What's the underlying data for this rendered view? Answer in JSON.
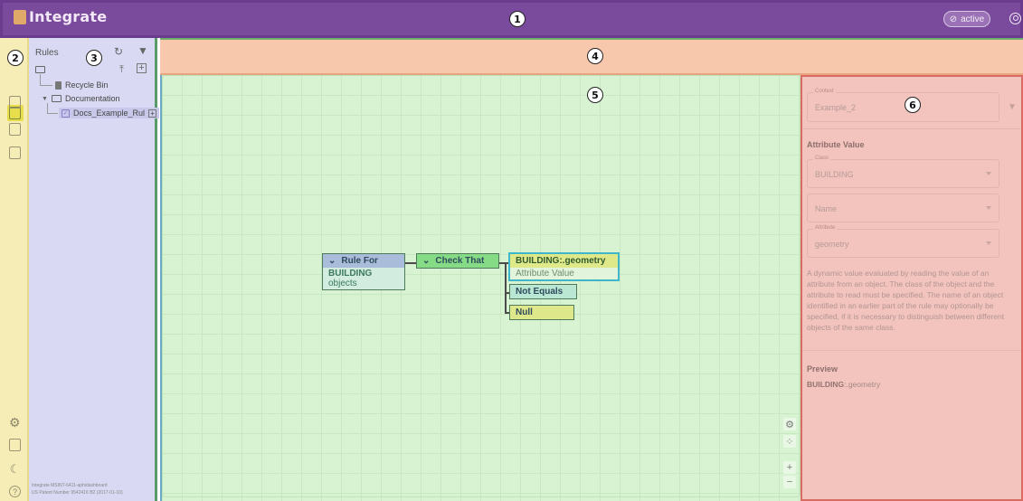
{
  "app": {
    "name": "Integrate",
    "status": "active"
  },
  "markers": [
    "1",
    "2",
    "3",
    "4",
    "5",
    "6"
  ],
  "tree": {
    "title": "Rules",
    "items": [
      {
        "label": "Recycle Bin",
        "icon": "trash-icon"
      },
      {
        "label": "Documentation",
        "icon": "folder-icon"
      },
      {
        "label": "Docs_Example_Rul",
        "icon": "rule-icon"
      }
    ],
    "footer": [
      "Integrate MSINT-6411-aphidashboard",
      "US Patent Number 9542416 B2 (2017-01-10)"
    ]
  },
  "diagram": {
    "rule_for": {
      "title": "Rule For",
      "subject": "BUILDING",
      "subject_suffix": "objects"
    },
    "check_that": {
      "title": "Check That"
    },
    "attribute_node": {
      "title": "BUILDING:.geometry",
      "subtitle": "Attribute Value"
    },
    "operator_node": {
      "title": "Not Equals"
    },
    "value_node": {
      "title": "Null"
    }
  },
  "properties": {
    "context": {
      "label": "Context",
      "value": "Example_2"
    },
    "section_title": "Attribute Value",
    "class_field": {
      "label": "Class",
      "value": "BUILDING"
    },
    "name_field": {
      "placeholder": "Name"
    },
    "attribute_field": {
      "label": "Attribute",
      "value": "geometry"
    },
    "description": "A dynamic value evaluated by reading the value of an attribute from an object. The class of the object and the attribute to read must be specified. The name of an object identified in an earlier part of the rule may optionally be specified, if it is necessary to distinguish between different objects of the same class.",
    "preview_title": "Preview",
    "preview": {
      "bold": "BUILDING",
      "rest": ":.geometry"
    }
  },
  "colors": {
    "topbar": "#7a4a9c",
    "rail": "#f5edb5",
    "tree": "#d9d9f3",
    "strip": "#f7c8ac",
    "canvas": "#d7f3d1",
    "props": "#f2c4bd"
  }
}
